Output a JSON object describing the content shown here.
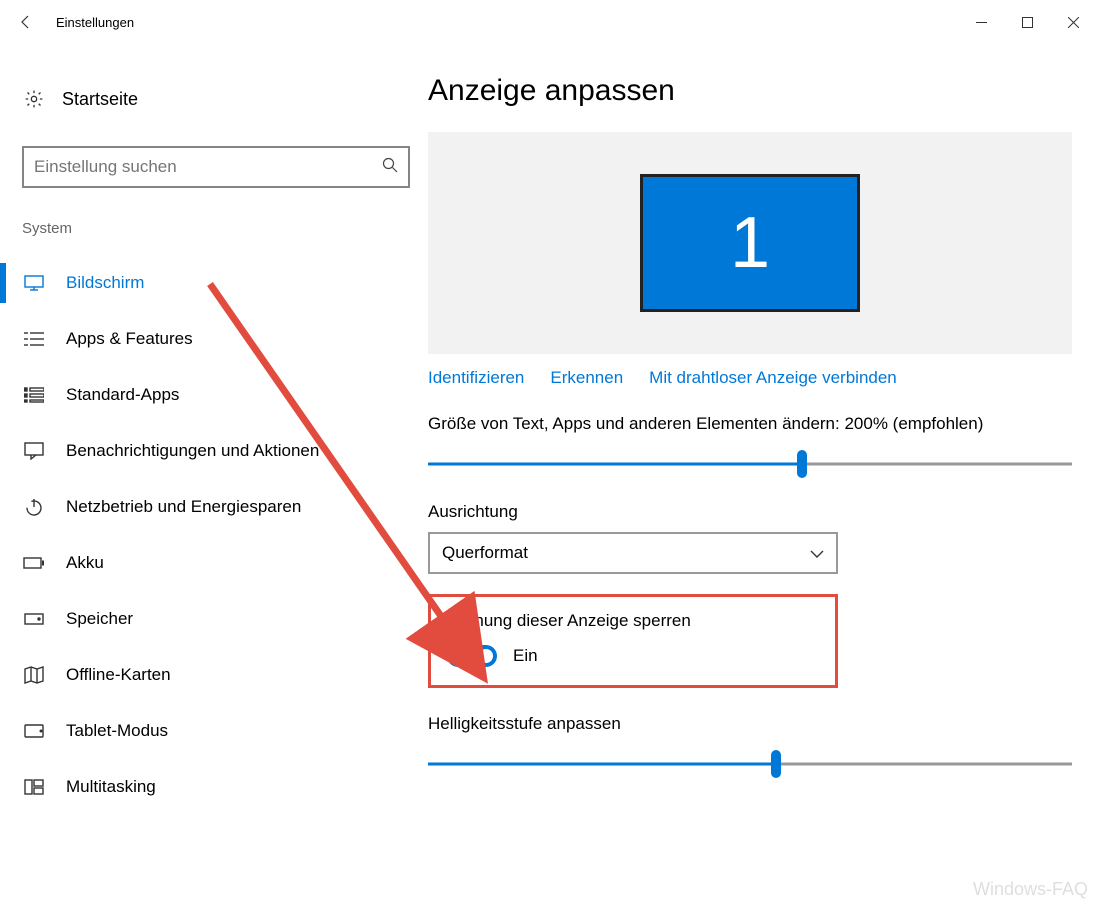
{
  "titlebar": {
    "title": "Einstellungen"
  },
  "sidebar": {
    "home_label": "Startseite",
    "search_placeholder": "Einstellung suchen",
    "category": "System",
    "items": [
      {
        "label": "Bildschirm"
      },
      {
        "label": "Apps & Features"
      },
      {
        "label": "Standard-Apps"
      },
      {
        "label": "Benachrichtigungen und Aktionen"
      },
      {
        "label": "Netzbetrieb und Energiesparen"
      },
      {
        "label": "Akku"
      },
      {
        "label": "Speicher"
      },
      {
        "label": "Offline-Karten"
      },
      {
        "label": "Tablet-Modus"
      },
      {
        "label": "Multitasking"
      }
    ]
  },
  "main": {
    "heading": "Anzeige anpassen",
    "monitor_number": "1",
    "links": {
      "identify": "Identifizieren",
      "detect": "Erkennen",
      "wireless": "Mit drahtloser Anzeige verbinden"
    },
    "scale_label": "Größe von Text, Apps und anderen Elementen ändern: 200% (empfohlen)",
    "scale_slider_percent": 58,
    "orientation_label": "Ausrichtung",
    "orientation_value": "Querformat",
    "rotation_lock_label": "Drehung dieser Anzeige sperren",
    "rotation_lock_value": "Ein",
    "brightness_label": "Helligkeitsstufe anpassen",
    "brightness_slider_percent": 54
  },
  "watermark": "Windows-FAQ"
}
